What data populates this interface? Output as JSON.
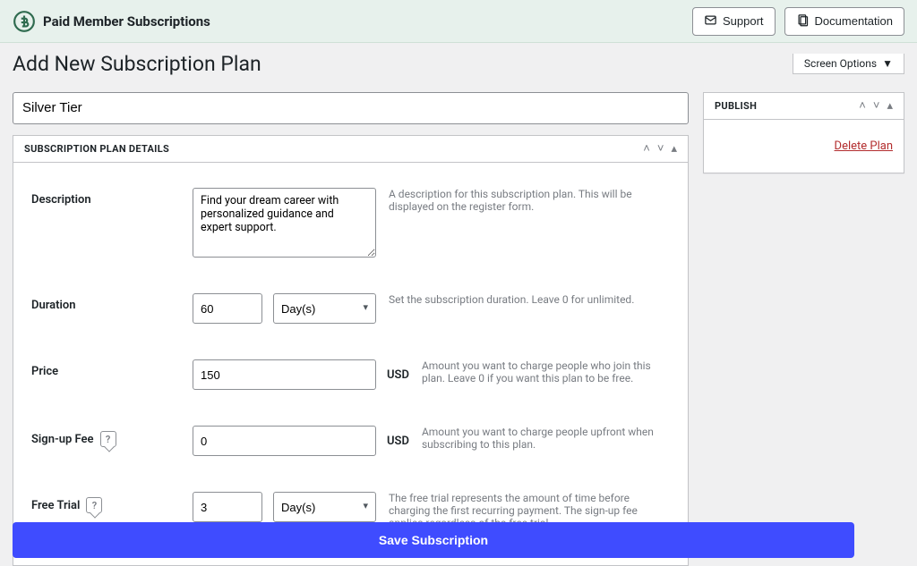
{
  "header": {
    "brand": "Paid Member Subscriptions",
    "support": "Support",
    "documentation": "Documentation"
  },
  "page": {
    "title": "Add New Subscription Plan",
    "screen_options": "Screen Options"
  },
  "plan": {
    "title_value": "Silver Tier"
  },
  "details_box": {
    "title": "Subscription Plan Details"
  },
  "publish_box": {
    "title": "Publish",
    "delete": "Delete Plan"
  },
  "fields": {
    "description": {
      "label": "Description",
      "value": "Find your dream career with personalized guidance and expert support.",
      "help": "A description for this subscription plan. This will be displayed on the register form."
    },
    "duration": {
      "label": "Duration",
      "value": "60",
      "unit": "Day(s)",
      "help": "Set the subscription duration. Leave 0 for unlimited."
    },
    "price": {
      "label": "Price",
      "value": "150",
      "currency": "USD",
      "help": "Amount you want to charge people who join this plan. Leave 0 if you want this plan to be free."
    },
    "signup_fee": {
      "label": "Sign-up Fee",
      "value": "0",
      "currency": "USD",
      "help": "Amount you want to charge people upfront when subscribing to this plan."
    },
    "free_trial": {
      "label": "Free Trial",
      "value": "3",
      "unit": "Day(s)",
      "help": "The free trial represents the amount of time before charging the first recurring payment. The sign-up fee applies regardless of the free trial."
    }
  },
  "actions": {
    "save": "Save Subscription"
  }
}
